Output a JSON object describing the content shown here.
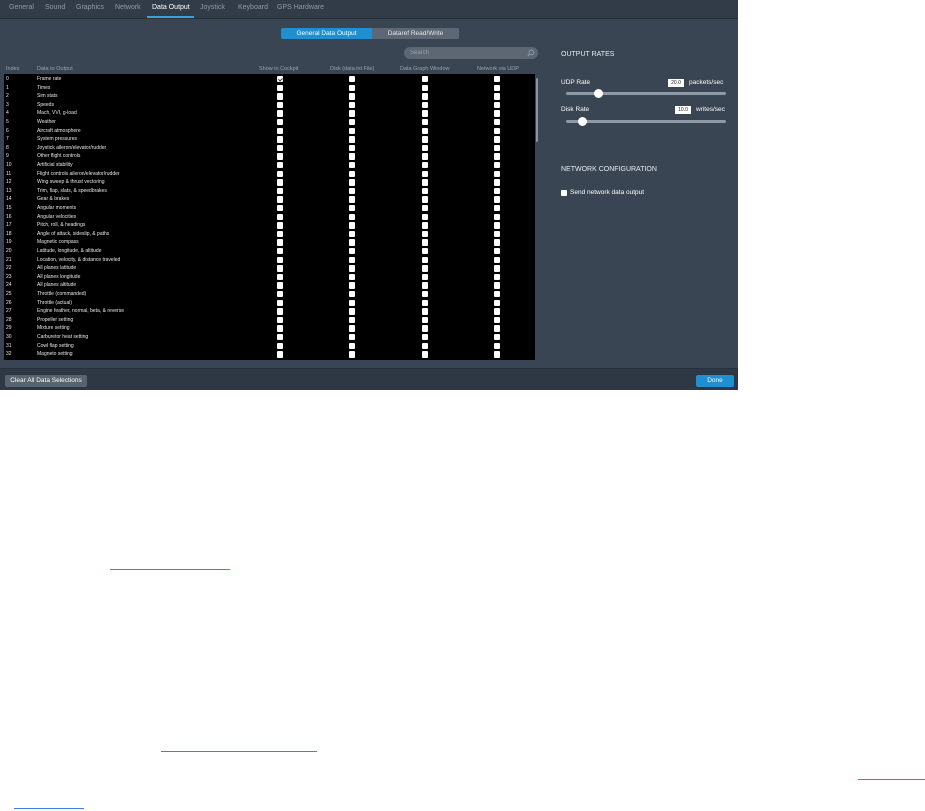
{
  "tabs": [
    "General",
    "Sound",
    "Graphics",
    "Network",
    "Data Output",
    "Joystick",
    "Keyboard",
    "GPS Hardware"
  ],
  "active_tab": "Data Output",
  "segments": {
    "general": "General Data Output",
    "dataref": "Dataref Read/Write"
  },
  "search": {
    "placeholder": "Search"
  },
  "columns": {
    "index": "Index",
    "data": "Data to Output",
    "cockpit": "Show in Cockpit",
    "disk": "Disk (data.txt File)",
    "graph": "Data Graph Window",
    "udp": "Network via UDP"
  },
  "rows": [
    {
      "index": "0",
      "label": "Frame rate"
    },
    {
      "index": "1",
      "label": "Times"
    },
    {
      "index": "2",
      "label": "Sim stats"
    },
    {
      "index": "3",
      "label": "Speeds"
    },
    {
      "index": "4",
      "label": "Mach, VVI, g-load"
    },
    {
      "index": "5",
      "label": "Weather"
    },
    {
      "index": "6",
      "label": "Aircraft atmosphere"
    },
    {
      "index": "7",
      "label": "System pressures"
    },
    {
      "index": "8",
      "label": "Joystick aileron/elevator/rudder"
    },
    {
      "index": "9",
      "label": "Other flight controls"
    },
    {
      "index": "10",
      "label": "Artificial stability"
    },
    {
      "index": "11",
      "label": "Flight controls aileron/elevator/rudder"
    },
    {
      "index": "12",
      "label": "Wing sweep & thrust vectoring"
    },
    {
      "index": "13",
      "label": "Trim, flap, slats, & speedbrakes"
    },
    {
      "index": "14",
      "label": "Gear & brakes"
    },
    {
      "index": "15",
      "label": "Angular moments"
    },
    {
      "index": "16",
      "label": "Angular velocities"
    },
    {
      "index": "17",
      "label": "Pitch, roll, & headings"
    },
    {
      "index": "18",
      "label": "Angle of attack, sideslip, & paths"
    },
    {
      "index": "19",
      "label": "Magnetic compass"
    },
    {
      "index": "20",
      "label": "Latitude, longitude, & altitude"
    },
    {
      "index": "21",
      "label": "Location, velocity, & distance traveled"
    },
    {
      "index": "22",
      "label": "All planes latitude"
    },
    {
      "index": "23",
      "label": "All planes longitude"
    },
    {
      "index": "24",
      "label": "All planes altitude"
    },
    {
      "index": "25",
      "label": "Throttle (commanded)"
    },
    {
      "index": "26",
      "label": "Throttle (actual)"
    },
    {
      "index": "27",
      "label": "Engine feather, normal, beta, & reverse"
    },
    {
      "index": "28",
      "label": "Propeller setting"
    },
    {
      "index": "29",
      "label": "Mixture setting"
    },
    {
      "index": "30",
      "label": "Carburetor heat setting"
    },
    {
      "index": "31",
      "label": "Cowl flap setting"
    },
    {
      "index": "32",
      "label": "Magneto setting"
    }
  ],
  "checked": {
    "row": "0",
    "column": "cockpit"
  },
  "output_rates": {
    "title": "OUTPUT RATES",
    "udp_label": "UDP Rate",
    "udp_value": "20.0",
    "udp_unit": "packets/sec",
    "udp_slider_fraction": 0.2,
    "disk_label": "Disk Rate",
    "disk_value": "10.0",
    "disk_unit": "writes/sec",
    "disk_slider_fraction": 0.1
  },
  "network": {
    "title": "NETWORK CONFIGURATION",
    "send_label": "Send network data output",
    "send_checked": false
  },
  "buttons": {
    "clear": "Clear All Data Selections",
    "done": "Done"
  },
  "colors": {
    "accent": "#1e8fd0",
    "panel": "#3a4553",
    "list_bg": "#000000",
    "link": "#3b82e6"
  }
}
